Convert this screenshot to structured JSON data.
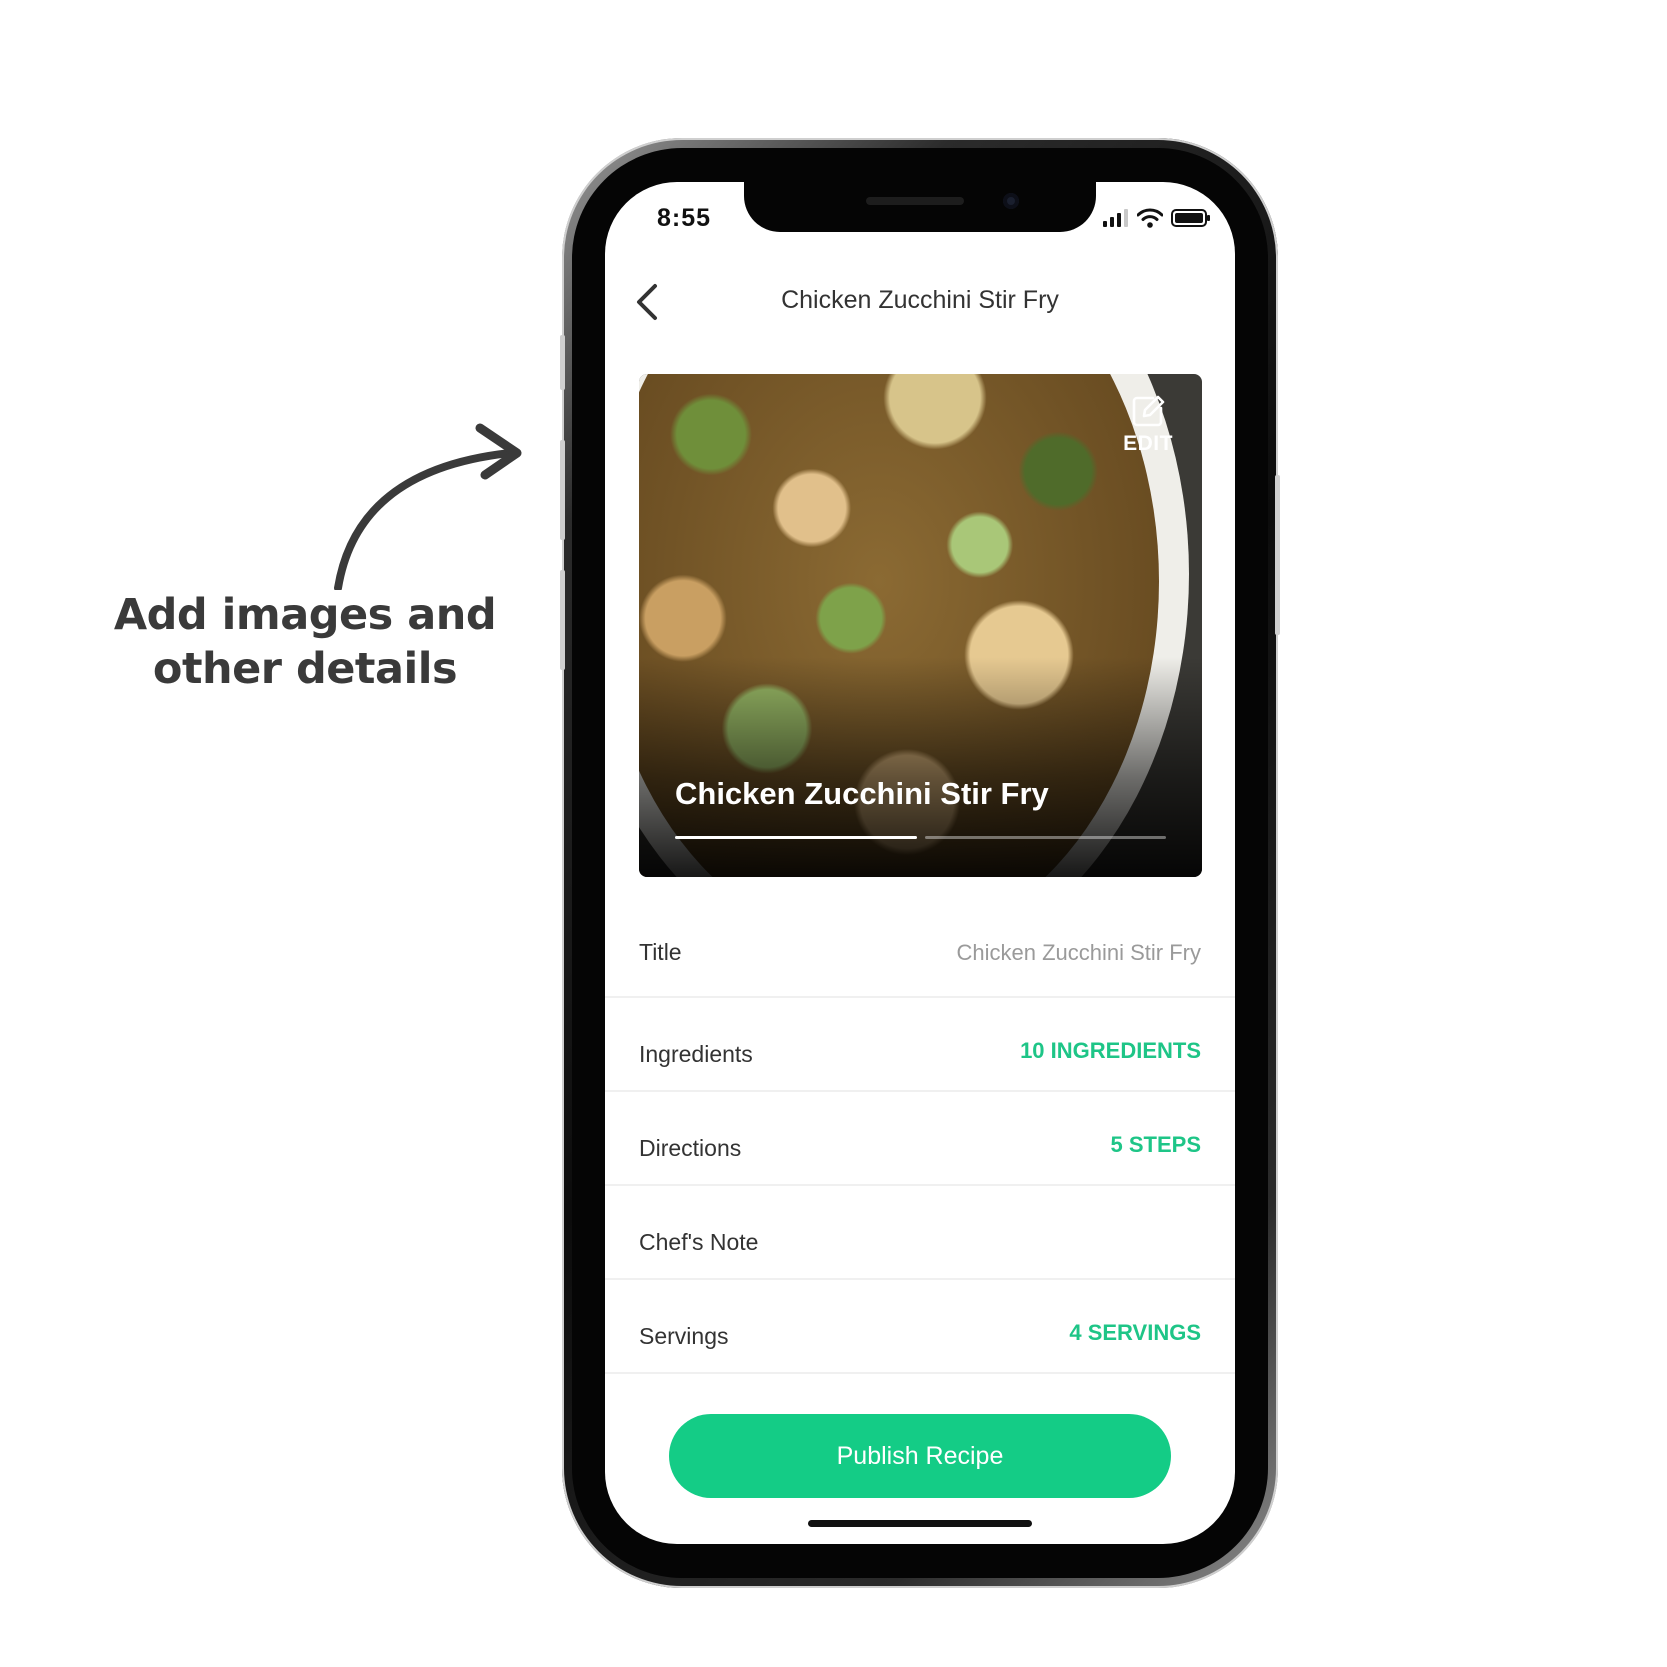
{
  "callout": {
    "text": "Add images and other details"
  },
  "status_bar": {
    "time": "8:55"
  },
  "header": {
    "back_icon": "chevron-left-icon",
    "title": "Chicken Zucchini Stir Fry"
  },
  "hero": {
    "title": "Chicken Zucchini Stir Fry",
    "edit_icon": "edit-icon",
    "edit_label": "EDIT",
    "carousel_pages": 2,
    "carousel_active_index": 0
  },
  "details": {
    "rows": [
      {
        "label": "Title",
        "value": "Chicken Zucchini Stir Fry"
      },
      {
        "label": "Ingredients",
        "value": "10 INGREDIENTS"
      },
      {
        "label": "Directions",
        "value": "5 STEPS"
      },
      {
        "label": "Chef's Note",
        "value": ""
      },
      {
        "label": "Servings",
        "value": "4 SERVINGS"
      }
    ]
  },
  "publish": {
    "label": "Publish Recipe"
  },
  "colors": {
    "accent": "#14cc86",
    "value_green": "#1ec587",
    "muted_text": "#9a9a9a",
    "callout_text": "#3a3a3a"
  }
}
